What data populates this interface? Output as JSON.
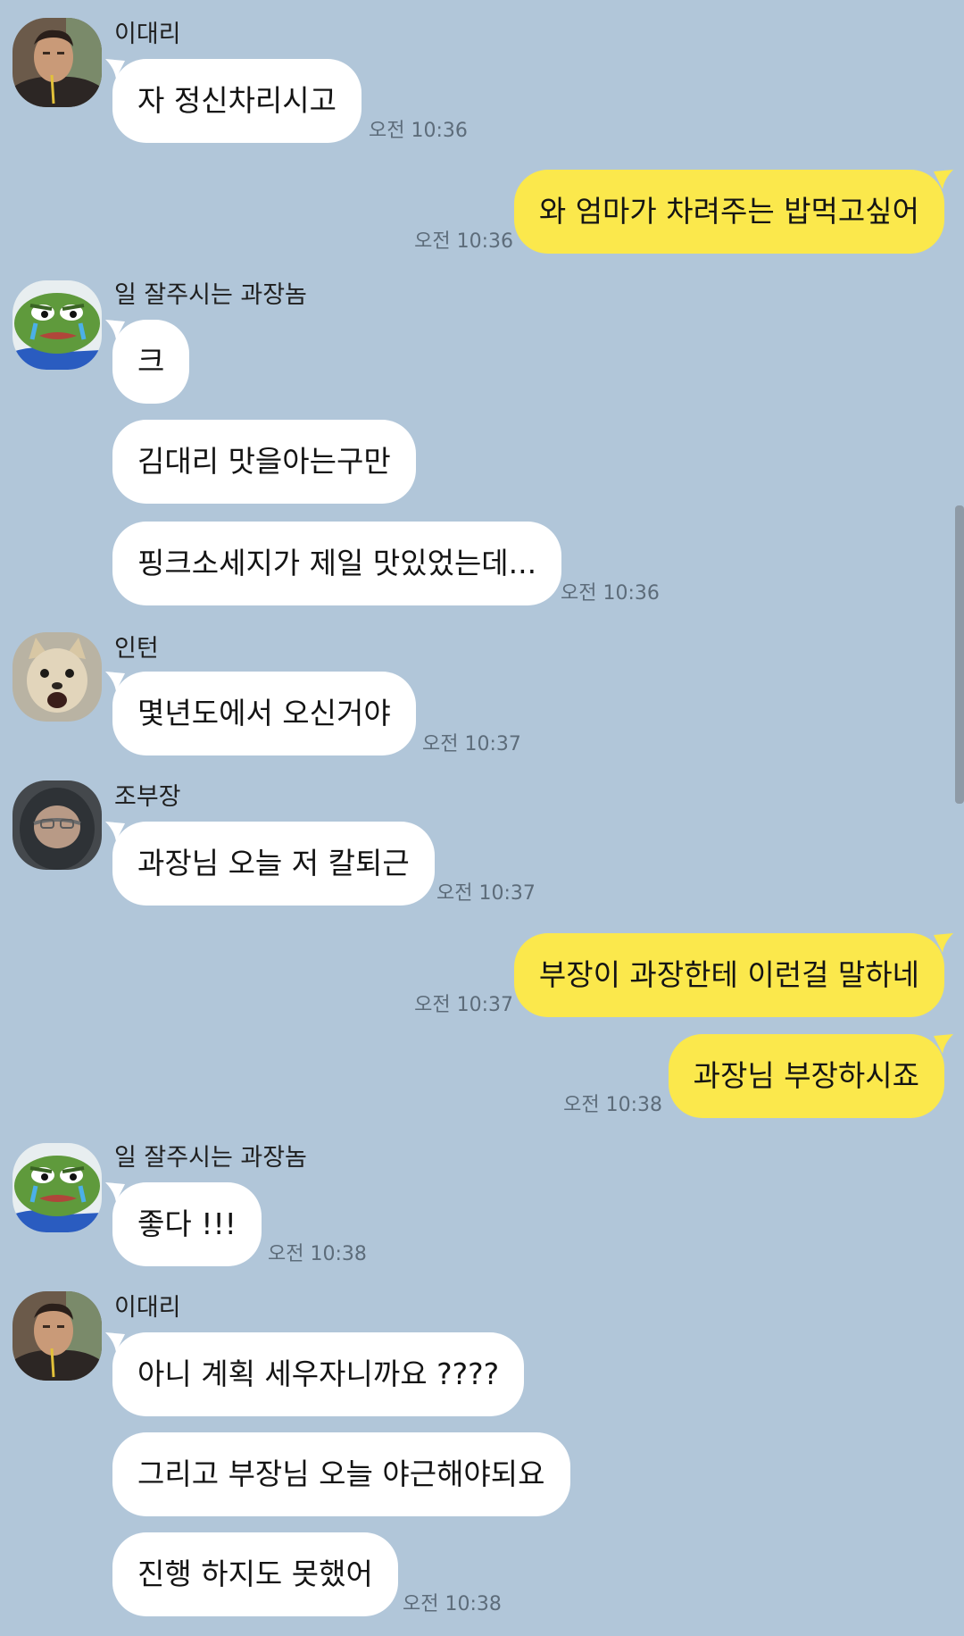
{
  "contacts": {
    "idaeri": "이대리",
    "gwajang": "일 잘주시는 과장놈",
    "intern": "인턴",
    "bujang": "조부장"
  },
  "messages": [
    {
      "text": "자 정신차리시고",
      "time": "오전 10:36"
    },
    {
      "text": "와 엄마가 차려주는 밥먹고싶어",
      "time": "오전 10:36"
    },
    {
      "text": "크"
    },
    {
      "text": "김대리 맛을아는구만"
    },
    {
      "text": "핑크소세지가 제일 맛있었는데...",
      "time": "오전 10:36"
    },
    {
      "text": "몇년도에서 오신거야",
      "time": "오전 10:37"
    },
    {
      "text": "과장님 오늘 저 칼퇴근",
      "time": "오전 10:37"
    },
    {
      "text": "부장이 과장한테 이런걸 말하네",
      "time": "오전 10:37"
    },
    {
      "text": "과장님 부장하시죠",
      "time": "오전 10:38"
    },
    {
      "text": "좋다 !!!",
      "time": "오전 10:38"
    },
    {
      "text": "아니 계획 세우자니까요 ????"
    },
    {
      "text": "그리고 부장님 오늘 야근해야되요"
    },
    {
      "text": "진행 하지도 못했어",
      "time": "오전 10:38"
    }
  ],
  "colors": {
    "background": "#b1c6d9",
    "incoming_bubble": "#ffffff",
    "outgoing_bubble": "#fbe84c",
    "timestamp": "#5d6c7a"
  },
  "icons": {
    "man_avatar": "man-avatar-icon",
    "frog_avatar": "frog-avatar-icon",
    "dog_avatar": "dog-avatar-icon",
    "hood_avatar": "hooded-person-avatar-icon"
  }
}
